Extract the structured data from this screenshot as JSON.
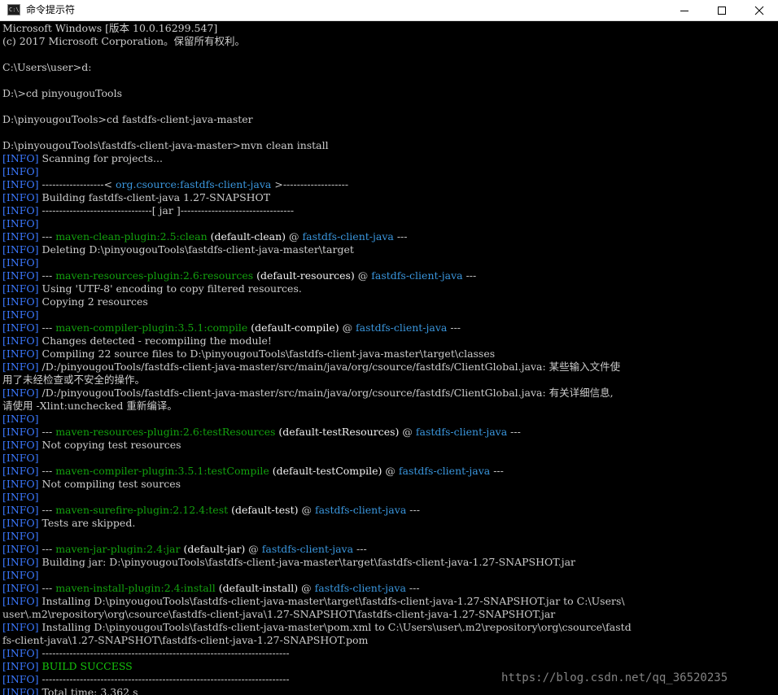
{
  "window": {
    "title": "命令提示符",
    "app_icon_text": "C:\\"
  },
  "console": {
    "lines": [
      [
        {
          "t": "Microsoft Windows [版本 10.0.16299.547]"
        }
      ],
      [
        {
          "t": "(c) 2017 Microsoft Corporation。保留所有权利。"
        }
      ],
      [
        {
          "t": ""
        }
      ],
      [
        {
          "t": "C:\\Users\\user>d:"
        }
      ],
      [
        {
          "t": ""
        }
      ],
      [
        {
          "t": "D:\\>cd pinyougouTools"
        }
      ],
      [
        {
          "t": ""
        }
      ],
      [
        {
          "t": "D:\\pinyougouTools>cd fastdfs-client-java-master"
        }
      ],
      [
        {
          "t": ""
        }
      ],
      [
        {
          "t": "D:\\pinyougouTools\\fastdfs-client-java-master>mvn clean install"
        }
      ],
      [
        {
          "t": "[INFO]",
          "c": "info"
        },
        {
          "t": " Scanning for projects..."
        }
      ],
      [
        {
          "t": "[INFO]",
          "c": "info"
        }
      ],
      [
        {
          "t": "[INFO]",
          "c": "info"
        },
        {
          "t": " ------------------< "
        },
        {
          "t": "org.csource:fastdfs-client-java",
          "c": "artifact"
        },
        {
          "t": " >-------------------"
        }
      ],
      [
        {
          "t": "[INFO]",
          "c": "info"
        },
        {
          "t": " Building fastdfs-client-java 1.27-SNAPSHOT"
        }
      ],
      [
        {
          "t": "[INFO]",
          "c": "info"
        },
        {
          "t": " --------------------------------[ jar ]---------------------------------"
        }
      ],
      [
        {
          "t": "[INFO]",
          "c": "info"
        }
      ],
      [
        {
          "t": "[INFO]",
          "c": "info"
        },
        {
          "t": " --- "
        },
        {
          "t": "maven-clean-plugin:2.5:clean",
          "c": "plugin"
        },
        {
          "t": " (default-clean)",
          "c": "white"
        },
        {
          "t": " @ "
        },
        {
          "t": "fastdfs-client-java",
          "c": "artifact"
        },
        {
          "t": " ---"
        }
      ],
      [
        {
          "t": "[INFO]",
          "c": "info"
        },
        {
          "t": " Deleting D:\\pinyougouTools\\fastdfs-client-java-master\\target"
        }
      ],
      [
        {
          "t": "[INFO]",
          "c": "info"
        }
      ],
      [
        {
          "t": "[INFO]",
          "c": "info"
        },
        {
          "t": " --- "
        },
        {
          "t": "maven-resources-plugin:2.6:resources",
          "c": "plugin"
        },
        {
          "t": " (default-resources)",
          "c": "white"
        },
        {
          "t": " @ "
        },
        {
          "t": "fastdfs-client-java",
          "c": "artifact"
        },
        {
          "t": " ---"
        }
      ],
      [
        {
          "t": "[INFO]",
          "c": "info"
        },
        {
          "t": " Using 'UTF-8' encoding to copy filtered resources."
        }
      ],
      [
        {
          "t": "[INFO]",
          "c": "info"
        },
        {
          "t": " Copying 2 resources"
        }
      ],
      [
        {
          "t": "[INFO]",
          "c": "info"
        }
      ],
      [
        {
          "t": "[INFO]",
          "c": "info"
        },
        {
          "t": " --- "
        },
        {
          "t": "maven-compiler-plugin:3.5.1:compile",
          "c": "plugin"
        },
        {
          "t": " (default-compile)",
          "c": "white"
        },
        {
          "t": " @ "
        },
        {
          "t": "fastdfs-client-java",
          "c": "artifact"
        },
        {
          "t": " ---"
        }
      ],
      [
        {
          "t": "[INFO]",
          "c": "info"
        },
        {
          "t": " Changes detected - recompiling the module!"
        }
      ],
      [
        {
          "t": "[INFO]",
          "c": "info"
        },
        {
          "t": " Compiling 22 source files to D:\\pinyougouTools\\fastdfs-client-java-master\\target\\classes"
        }
      ],
      [
        {
          "t": "[INFO]",
          "c": "info"
        },
        {
          "t": " /D:/pinyougouTools/fastdfs-client-java-master/src/main/java/org/csource/fastdfs/ClientGlobal.java: 某些输入文件使"
        }
      ],
      [
        {
          "t": "用了未经检查或不安全的操作。"
        }
      ],
      [
        {
          "t": "[INFO]",
          "c": "info"
        },
        {
          "t": " /D:/pinyougouTools/fastdfs-client-java-master/src/main/java/org/csource/fastdfs/ClientGlobal.java: 有关详细信息,"
        }
      ],
      [
        {
          "t": "请使用 -Xlint:unchecked 重新编译。"
        }
      ],
      [
        {
          "t": "[INFO]",
          "c": "info"
        }
      ],
      [
        {
          "t": "[INFO]",
          "c": "info"
        },
        {
          "t": " --- "
        },
        {
          "t": "maven-resources-plugin:2.6:testResources",
          "c": "plugin"
        },
        {
          "t": " (default-testResources)",
          "c": "white"
        },
        {
          "t": " @ "
        },
        {
          "t": "fastdfs-client-java",
          "c": "artifact"
        },
        {
          "t": " ---"
        }
      ],
      [
        {
          "t": "[INFO]",
          "c": "info"
        },
        {
          "t": " Not copying test resources"
        }
      ],
      [
        {
          "t": "[INFO]",
          "c": "info"
        }
      ],
      [
        {
          "t": "[INFO]",
          "c": "info"
        },
        {
          "t": " --- "
        },
        {
          "t": "maven-compiler-plugin:3.5.1:testCompile",
          "c": "plugin"
        },
        {
          "t": " (default-testCompile)",
          "c": "white"
        },
        {
          "t": " @ "
        },
        {
          "t": "fastdfs-client-java",
          "c": "artifact"
        },
        {
          "t": " ---"
        }
      ],
      [
        {
          "t": "[INFO]",
          "c": "info"
        },
        {
          "t": " Not compiling test sources"
        }
      ],
      [
        {
          "t": "[INFO]",
          "c": "info"
        }
      ],
      [
        {
          "t": "[INFO]",
          "c": "info"
        },
        {
          "t": " --- "
        },
        {
          "t": "maven-surefire-plugin:2.12.4:test",
          "c": "plugin"
        },
        {
          "t": " (default-test)",
          "c": "white"
        },
        {
          "t": " @ "
        },
        {
          "t": "fastdfs-client-java",
          "c": "artifact"
        },
        {
          "t": " ---"
        }
      ],
      [
        {
          "t": "[INFO]",
          "c": "info"
        },
        {
          "t": " Tests are skipped."
        }
      ],
      [
        {
          "t": "[INFO]",
          "c": "info"
        }
      ],
      [
        {
          "t": "[INFO]",
          "c": "info"
        },
        {
          "t": " --- "
        },
        {
          "t": "maven-jar-plugin:2.4:jar",
          "c": "plugin"
        },
        {
          "t": " (default-jar)",
          "c": "white"
        },
        {
          "t": " @ "
        },
        {
          "t": "fastdfs-client-java",
          "c": "artifact"
        },
        {
          "t": " ---"
        }
      ],
      [
        {
          "t": "[INFO]",
          "c": "info"
        },
        {
          "t": " Building jar: D:\\pinyougouTools\\fastdfs-client-java-master\\target\\fastdfs-client-java-1.27-SNAPSHOT.jar"
        }
      ],
      [
        {
          "t": "[INFO]",
          "c": "info"
        }
      ],
      [
        {
          "t": "[INFO]",
          "c": "info"
        },
        {
          "t": " --- "
        },
        {
          "t": "maven-install-plugin:2.4:install",
          "c": "plugin"
        },
        {
          "t": " (default-install)",
          "c": "white"
        },
        {
          "t": " @ "
        },
        {
          "t": "fastdfs-client-java",
          "c": "artifact"
        },
        {
          "t": " ---"
        }
      ],
      [
        {
          "t": "[INFO]",
          "c": "info"
        },
        {
          "t": " Installing D:\\pinyougouTools\\fastdfs-client-java-master\\target\\fastdfs-client-java-1.27-SNAPSHOT.jar to C:\\Users\\"
        }
      ],
      [
        {
          "t": "user\\.m2\\repository\\org\\csource\\fastdfs-client-java\\1.27-SNAPSHOT\\fastdfs-client-java-1.27-SNAPSHOT.jar"
        }
      ],
      [
        {
          "t": "[INFO]",
          "c": "info"
        },
        {
          "t": " Installing D:\\pinyougouTools\\fastdfs-client-java-master\\pom.xml to C:\\Users\\user\\.m2\\repository\\org\\csource\\fastd"
        }
      ],
      [
        {
          "t": "fs-client-java\\1.27-SNAPSHOT\\fastdfs-client-java-1.27-SNAPSHOT.pom"
        }
      ],
      [
        {
          "t": "[INFO]",
          "c": "info"
        },
        {
          "t": " ------------------------------------------------------------------------"
        }
      ],
      [
        {
          "t": "[INFO]",
          "c": "info"
        },
        {
          "t": " BUILD SUCCESS",
          "c": "green"
        }
      ],
      [
        {
          "t": "[INFO]",
          "c": "info"
        },
        {
          "t": " ------------------------------------------------------------------------"
        }
      ],
      [
        {
          "t": "[INFO]",
          "c": "info"
        },
        {
          "t": " Total time: 3.362 s"
        }
      ]
    ]
  },
  "watermark": "https://blog.csdn.net/qq_36520235",
  "colors": {
    "background": "#000000",
    "text": "#cccccc",
    "info": "#3b78ff",
    "plugin": "#13a10e",
    "artifact": "#3a96dd",
    "success": "#16c60c"
  }
}
